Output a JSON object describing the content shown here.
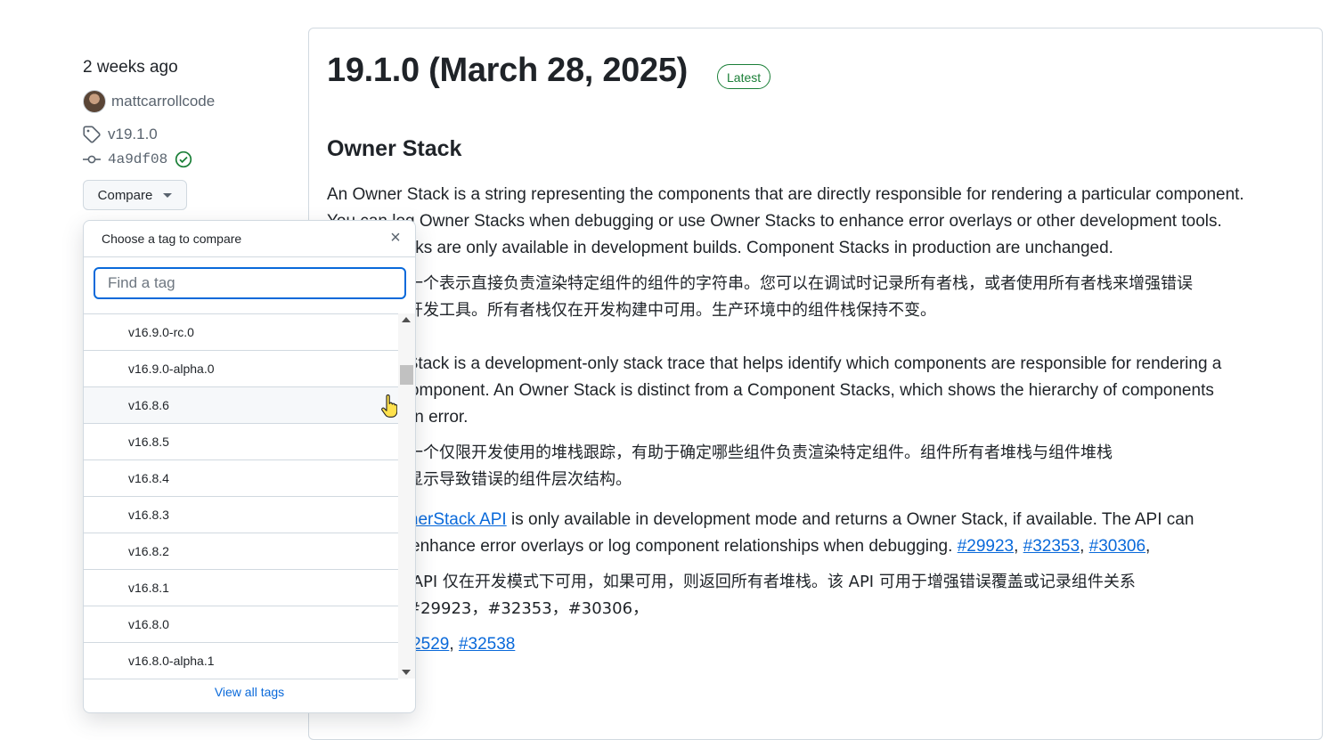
{
  "meta": {
    "time": "2 weeks ago",
    "author": "mattcarrollcode",
    "tag": "v19.1.0",
    "commit": "4a9df08",
    "compare_label": "Compare"
  },
  "release": {
    "title": "19.1.0 (March 28, 2025)",
    "badge": "Latest",
    "section_heading": "Owner Stack",
    "p1_line1": "An Owner Stack is a string representing the components that are directly responsible for rendering a particular component.",
    "p1_line2": "You can log Owner Stacks when debugging or use Owner Stacks to enhance error overlays or other development tools.",
    "p1_line3": "Owner Stacks are only available in development builds. Component Stacks in production are unchanged.",
    "p2_line1": "所有者栈是一个表示直接负责渲染特定组件的组件的字符串。您可以在调试时记录所有者栈，或者使用所有者栈来增强错误",
    "p2_line2": "覆盖或其他开发工具。所有者栈仅在开发构建中可用。生产环境中的组件栈保持不变。",
    "p3_line1": "An Owner Stack is a development-only stack trace that helps identify which components are responsible for rendering a",
    "p3_line2": "particular component. An Owner Stack is distinct from a Component Stacks, which shows the hierarchy of components",
    "p3_line3": "leading to an error.",
    "p4_line1": "所有者栈是一个仅限开发使用的堆栈跟踪，有助于确定哪些组件负责渲染特定组件。组件所有者堆栈与组件堆栈",
    "p4_line2": "不同，后者显示导致错误的组件层次结构。",
    "p5_link": "captureOwnerStack API",
    "p5_line1_rest": " is only available in development mode and returns a Owner Stack, if available. The API can",
    "p5_line2": "be used to enhance error overlays or log component relationships when debugging. ",
    "p5_refs": [
      "#29923",
      "#32353",
      "#30306"
    ],
    "p6_line1": "所有者堆栈 API 仅在开发模式下可用，如果可用，则返回所有者堆栈。该 API 可用于增强错误覆盖或记录组件关系",
    "p6_line2": "以便调试。#29923，#32353，#30306，",
    "p7_refs": [
      "#32538",
      "#32529",
      "#32538"
    ]
  },
  "dropdown": {
    "title": "Choose a tag to compare",
    "search_placeholder": "Find a tag",
    "items": [
      "v16.9.0-rc.0",
      "v16.9.0-alpha.0",
      "v16.8.6",
      "v16.8.5",
      "v16.8.4",
      "v16.8.3",
      "v16.8.2",
      "v16.8.1",
      "v16.8.0",
      "v16.8.0-alpha.1"
    ],
    "hovered_item": "v16.8.6",
    "footer": "View all tags"
  }
}
